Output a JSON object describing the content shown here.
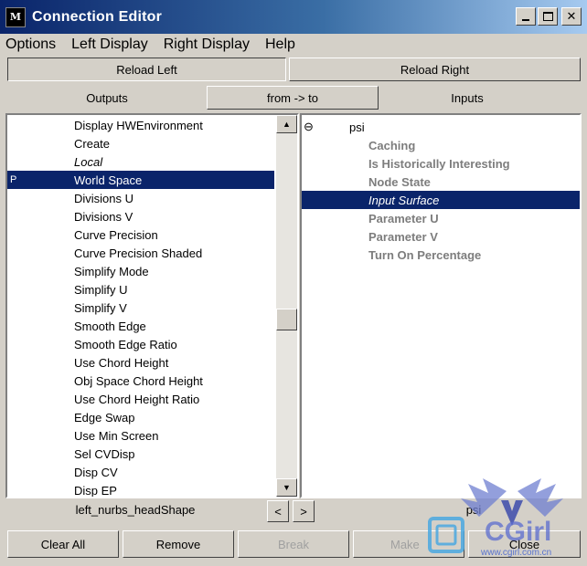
{
  "window": {
    "title": "Connection Editor",
    "icon_text": "M"
  },
  "menubar": {
    "items": [
      "Options",
      "Left Display",
      "Right Display",
      "Help"
    ]
  },
  "toolbar": {
    "reload_left": "Reload Left",
    "reload_right": "Reload Right",
    "outputs_label": "Outputs",
    "direction_button": "from -> to",
    "inputs_label": "Inputs"
  },
  "left_list": {
    "items": [
      {
        "label": "Display HWEnvironment"
      },
      {
        "label": "Create"
      },
      {
        "label": "Local",
        "italic": true
      },
      {
        "label": "World Space",
        "selected": true,
        "marker": "P"
      },
      {
        "label": "Divisions U"
      },
      {
        "label": "Divisions V"
      },
      {
        "label": "Curve Precision"
      },
      {
        "label": "Curve Precision Shaded"
      },
      {
        "label": "Simplify Mode"
      },
      {
        "label": "Simplify U"
      },
      {
        "label": "Simplify V"
      },
      {
        "label": "Smooth Edge"
      },
      {
        "label": "Smooth Edge Ratio"
      },
      {
        "label": "Use Chord Height"
      },
      {
        "label": "Obj Space Chord Height"
      },
      {
        "label": "Use Chord Height Ratio"
      },
      {
        "label": "Edge Swap"
      },
      {
        "label": "Use Min Screen"
      },
      {
        "label": "Sel CVDisp"
      },
      {
        "label": "Disp CV"
      },
      {
        "label": "Disp EP"
      }
    ],
    "node_name": "left_nurbs_headShape"
  },
  "right_list": {
    "root": {
      "label": "psi",
      "expander": "⊖"
    },
    "items": [
      {
        "label": "Caching"
      },
      {
        "label": "Is Historically Interesting"
      },
      {
        "label": "Node State"
      },
      {
        "label": "Input Surface",
        "selected": true,
        "italic": true
      },
      {
        "label": "Parameter U"
      },
      {
        "label": "Parameter V"
      },
      {
        "label": "Turn On Percentage"
      }
    ],
    "node_name": "psi"
  },
  "nav": {
    "prev": "<",
    "next": ">"
  },
  "bottom": {
    "clear_all": "Clear All",
    "remove": "Remove",
    "break": "Break",
    "make": "Make",
    "close": "Close"
  },
  "watermark": {
    "text": "CGirl",
    "site": "www.cgirl.com.cn"
  },
  "colors": {
    "selection": "#0a246a",
    "face": "#d4d0c8",
    "title_start": "#0a246a",
    "title_end": "#a6caf0"
  }
}
